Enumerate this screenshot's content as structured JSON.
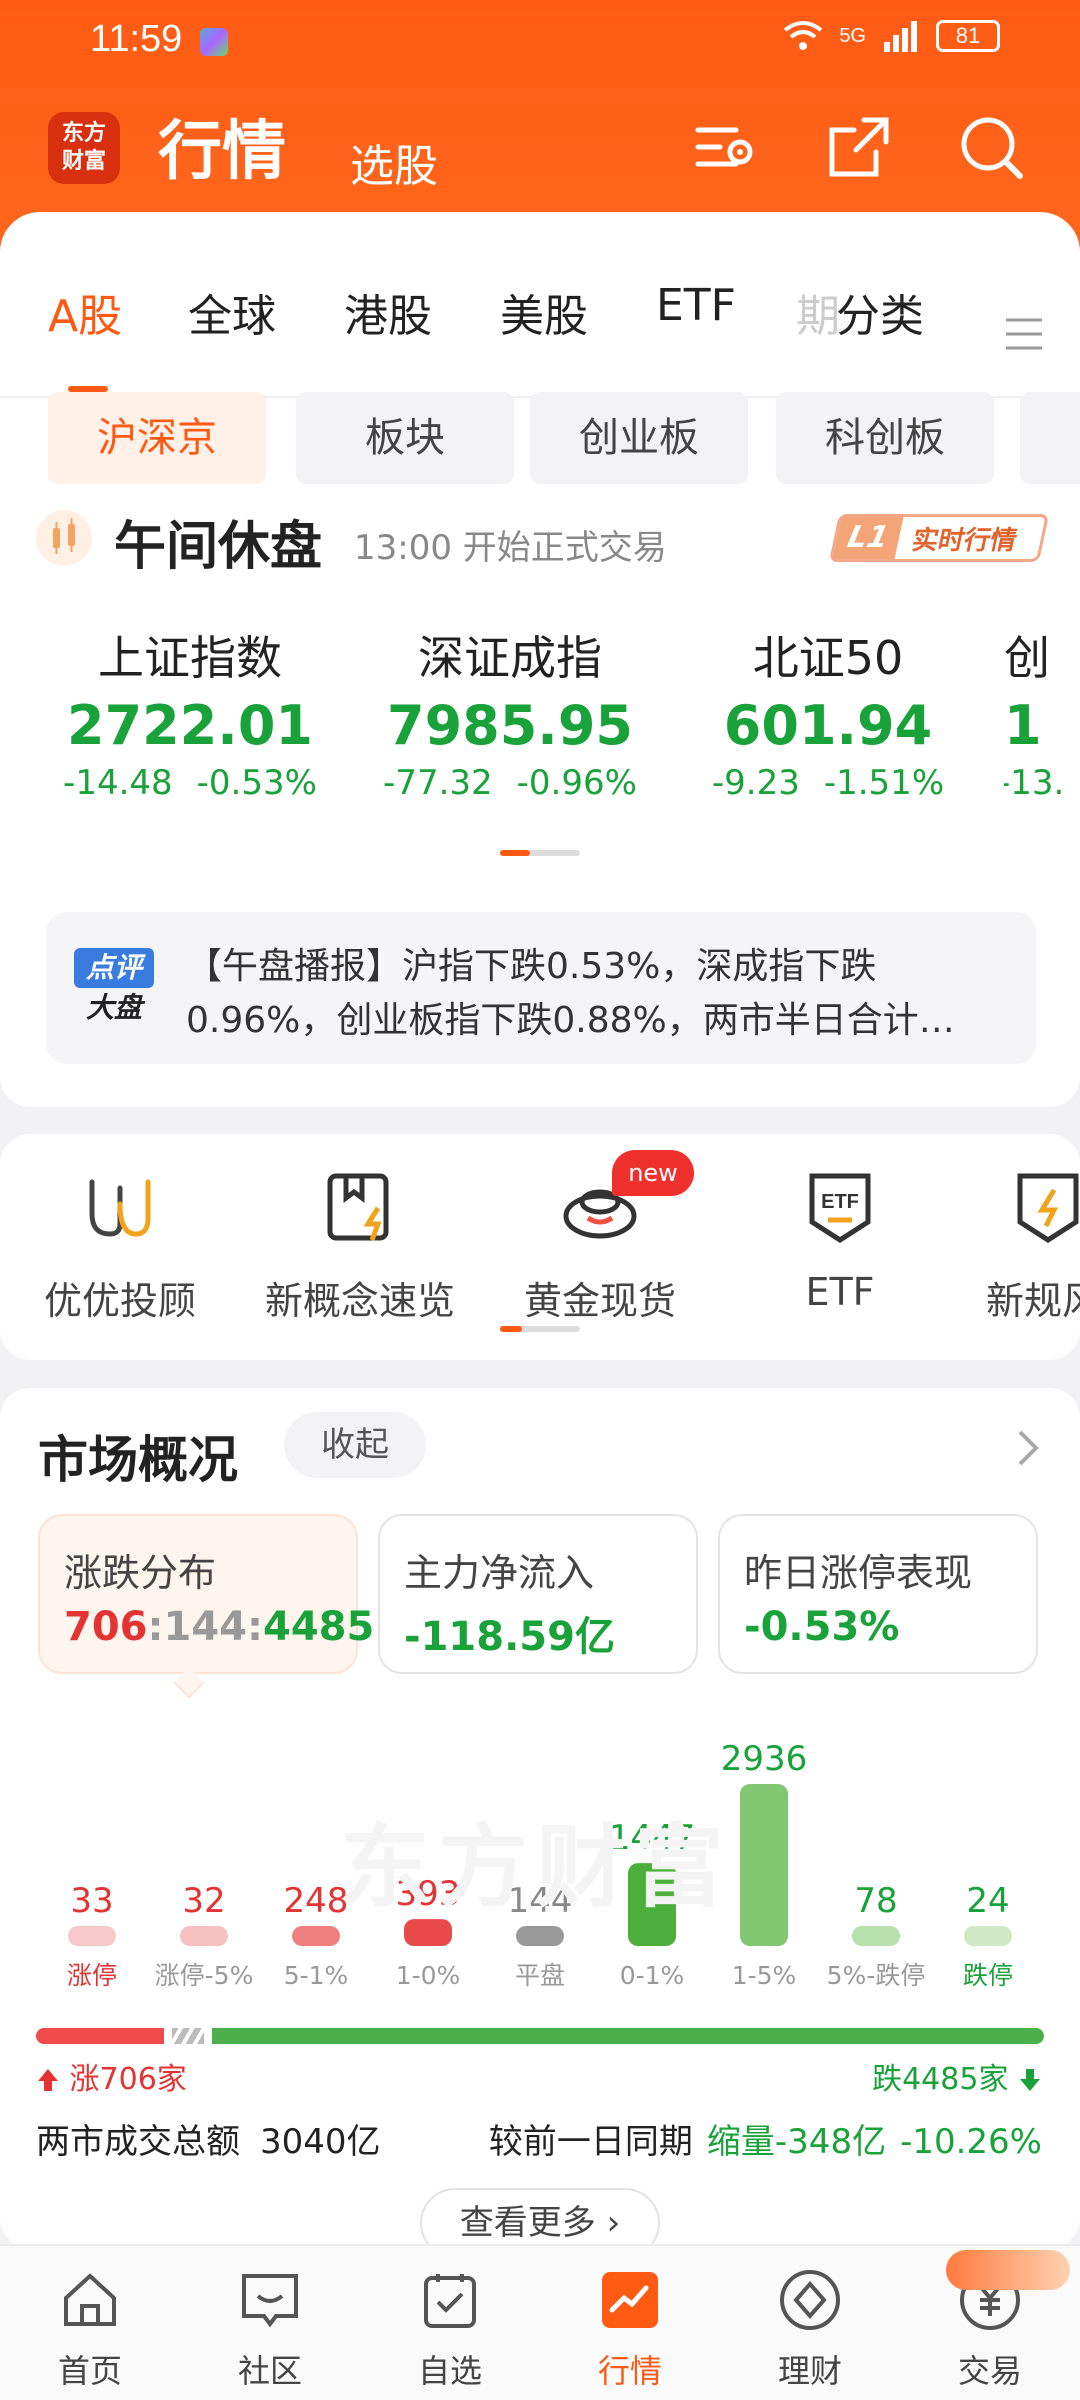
{
  "status_bar": {
    "time": "11:59",
    "network": "5G",
    "battery": "81"
  },
  "header": {
    "logo_text": "东方\n财富",
    "title": "行情",
    "subtitle": "选股"
  },
  "tabs": [
    {
      "label": "A股"
    },
    {
      "label": "全球"
    },
    {
      "label": "港股"
    },
    {
      "label": "美股"
    },
    {
      "label": "ETF"
    },
    {
      "label": "期"
    },
    {
      "label": "分类"
    }
  ],
  "chips": [
    {
      "label": "沪深京"
    },
    {
      "label": "板块"
    },
    {
      "label": "创业板"
    },
    {
      "label": "科创板"
    }
  ],
  "market_status": {
    "title": "午间休盘",
    "subtitle": "13:00 开始正式交易",
    "badge_l1": "L1",
    "badge_text": "实时行情"
  },
  "indices": [
    {
      "name": "上证指数",
      "value": "2722.01",
      "change": "-14.48",
      "pct": "-0.53%"
    },
    {
      "name": "深证成指",
      "value": "7985.95",
      "change": "-77.32",
      "pct": "-0.96%"
    },
    {
      "name": "北证50",
      "value": "601.94",
      "change": "-9.23",
      "pct": "-1.51%"
    },
    {
      "name": "创",
      "value": "1",
      "change": "-13.",
      "pct": ""
    }
  ],
  "news": {
    "badge_top": "点评",
    "badge_bottom": "大盘",
    "text": "【午盘播报】沪指下跌0.53%，深成指下跌0.96%，创业板指下跌0.88%，两市半日合计…"
  },
  "shortcuts": [
    {
      "label": "优优投顾",
      "icon": "uu-icon"
    },
    {
      "label": "新概念速览",
      "icon": "bookmark-bolt-icon"
    },
    {
      "label": "黄金现货",
      "icon": "gold-ingot-icon"
    },
    {
      "label": "ETF",
      "icon": "etf-shield-icon"
    },
    {
      "label": "新规风",
      "icon": "shield-bolt-icon"
    }
  ],
  "new_badge": "new",
  "market_overview": {
    "title": "市场概况",
    "collapse": "收起",
    "stats": [
      {
        "label": "涨跌分布",
        "up": "706",
        "flat": "144",
        "down": "4485",
        "sep": ":"
      },
      {
        "label": "主力净流入",
        "value": "-118.59亿"
      },
      {
        "label": "昨日涨停表现",
        "value": "-0.53%"
      }
    ],
    "watermark": "东方财富",
    "rise_label": "涨706家",
    "fall_label": "跌4485家",
    "turnover_label": "两市成交总额",
    "turnover_value": "3040亿",
    "compare_label": "较前一日同期",
    "compare_value": "缩量-348亿",
    "compare_pct": "-10.26%",
    "more": "查看更多"
  },
  "chart_data": {
    "type": "bar",
    "categories": [
      "涨停",
      "涨停-5%",
      "5-1%",
      "1-0%",
      "平盘",
      "0-1%",
      "1-5%",
      "5%-跌停",
      "跌停"
    ],
    "values": [
      33,
      32,
      248,
      393,
      144,
      1447,
      2936,
      78,
      24
    ],
    "colors": [
      "#f7c9c9",
      "#f7c0c0",
      "#f08080",
      "#e84a4a",
      "#999999",
      "#4caf3c",
      "#82c772",
      "#b7e0aa",
      "#cfe9c5"
    ],
    "label_colors": [
      "#e43333",
      "#e43333",
      "#e43333",
      "#e43333",
      "#888888",
      "#19a13a",
      "#19a13a",
      "#19a13a",
      "#19a13a"
    ],
    "category_colors": [
      "#e43333",
      "#999999",
      "#999999",
      "#999999",
      "#999999",
      "#999999",
      "#999999",
      "#999999",
      "#19a13a"
    ]
  },
  "bottom_nav": [
    {
      "label": "首页",
      "icon": "home-icon"
    },
    {
      "label": "社区",
      "icon": "chat-icon"
    },
    {
      "label": "自选",
      "icon": "watchlist-icon"
    },
    {
      "label": "行情",
      "icon": "market-chart-icon"
    },
    {
      "label": "理财",
      "icon": "wealth-diamond-icon"
    },
    {
      "label": "交易",
      "icon": "trade-yen-icon"
    }
  ],
  "colors": {
    "brand": "#ff5a14",
    "rise": "#e43333",
    "fall": "#19a13a"
  }
}
